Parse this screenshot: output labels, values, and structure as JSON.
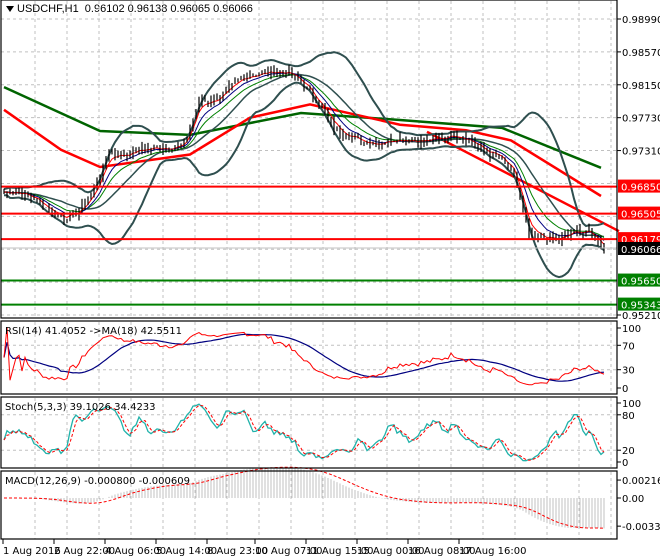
{
  "header": {
    "symbol": "USDCHF,H1",
    "open": "0.96102",
    "high": "0.96138",
    "low": "0.96065",
    "close": "0.96066"
  },
  "chart_data": {
    "type": "line",
    "title": "USDCHF,H1",
    "price_axis": {
      "range": [
        0.9521,
        0.9899
      ],
      "ticks": [
        {
          "value": 0.9899,
          "label": "0.98990"
        },
        {
          "value": 0.9857,
          "label": "0.98570"
        },
        {
          "value": 0.9815,
          "label": "0.98150"
        },
        {
          "value": 0.9773,
          "label": "0.97730"
        },
        {
          "value": 0.9731,
          "label": "0.97310"
        },
        {
          "value": 0.9521,
          "label": "0.95210"
        }
      ]
    },
    "time_axis": {
      "bars": 203,
      "ticks": [
        {
          "bar": 0,
          "label": "1 Aug 2016"
        },
        {
          "bar": 17,
          "label": "2 Aug 22:00"
        },
        {
          "bar": 34,
          "label": "4 Aug 06:00"
        },
        {
          "bar": 51,
          "label": "5 Aug 14:00"
        },
        {
          "bar": 68,
          "label": "8 Aug 23:00"
        },
        {
          "bar": 84,
          "label": "10 Aug 07:00"
        },
        {
          "bar": 101,
          "label": "11 Aug 15:00"
        },
        {
          "bar": 118,
          "label": "15 Aug 00:00"
        },
        {
          "bar": 135,
          "label": "16 Aug 08:00"
        },
        {
          "bar": 152,
          "label": "17 Aug 16:00"
        }
      ]
    },
    "close_every_5_bars": [
      0.9678,
      0.9678,
      0.967,
      0.9655,
      0.9645,
      0.9653,
      0.9681,
      0.9729,
      0.9725,
      0.9732,
      0.9734,
      0.9735,
      0.9738,
      0.9795,
      0.9795,
      0.981,
      0.9826,
      0.9829,
      0.9832,
      0.983,
      0.9815,
      0.979,
      0.976,
      0.9749,
      0.9742,
      0.974,
      0.9746,
      0.9745,
      0.9743,
      0.9746,
      0.9752,
      0.9745,
      0.973,
      0.9723,
      0.97,
      0.9622,
      0.9619,
      0.9617,
      0.9628,
      0.9627,
      0.9607
    ],
    "ma_slow_green": [
      [
        0,
        0.9812
      ],
      [
        32,
        0.9756
      ],
      [
        62,
        0.9751
      ],
      [
        99,
        0.9779
      ],
      [
        132,
        0.977
      ],
      [
        166,
        0.976
      ],
      [
        199,
        0.9709
      ]
    ],
    "ma_slow_red": [
      [
        0,
        0.9783
      ],
      [
        19,
        0.9732
      ],
      [
        32,
        0.971
      ],
      [
        62,
        0.9726
      ],
      [
        82,
        0.9773
      ],
      [
        102,
        0.979
      ],
      [
        132,
        0.9764
      ],
      [
        154,
        0.9757
      ],
      [
        169,
        0.9744
      ],
      [
        199,
        0.9673
      ]
    ],
    "trendline": [
      [
        141,
        0.9755
      ],
      [
        205,
        0.9628
      ]
    ],
    "levels": [
      {
        "value": 0.9685,
        "label": "0.96850",
        "color": "#ff0000"
      },
      {
        "value": 0.96505,
        "label": "0.96505",
        "color": "#ff0000"
      },
      {
        "value": 0.96179,
        "label": "0.96179",
        "color": "#ff0000"
      },
      {
        "value": 0.9565,
        "label": "0.95650",
        "color": "#008000"
      },
      {
        "value": 0.95343,
        "label": "0.95343",
        "color": "#008000"
      }
    ],
    "current_price": {
      "value": 0.96066,
      "label": "0.96066",
      "color": "#000000"
    },
    "rsi": {
      "label": "RSI(14) 41.4052  ->MA(18) 42.5511",
      "ticks": [
        {
          "v": 100,
          "label": "100"
        },
        {
          "v": 70,
          "label": "70"
        },
        {
          "v": 30,
          "label": "30"
        },
        {
          "v": 0,
          "label": "0"
        }
      ],
      "line_color": "#ff0000",
      "ma_color": "#000080"
    },
    "stoch": {
      "label": "Stoch(5,3,3) 39.1026 34.4233",
      "ticks": [
        {
          "v": 100,
          "label": "100"
        },
        {
          "v": 80,
          "label": "80"
        },
        {
          "v": 20,
          "label": "20"
        },
        {
          "v": 0,
          "label": "0"
        }
      ],
      "main_color": "#20b2aa",
      "signal_color": "#ff0000"
    },
    "macd": {
      "label": "MACD(12,26,9) -0.000800 -0.000609",
      "ticks": [
        {
          "v": 0.002161,
          "label": "0.002161"
        },
        {
          "v": 0,
          "label": "0.00"
        },
        {
          "v": -0.003391,
          "label": "-0.003391"
        }
      ],
      "hist_color": "#c0c0c0",
      "signal_color": "#ff0000"
    },
    "colors": {
      "bollinger": "#2f4f4f",
      "bars": "#000000",
      "ema_fast": "#ff0000",
      "ema_mid": "#000080",
      "ema_slow": "#008000",
      "ma_green": "#006400",
      "ma_red": "#ff0000",
      "grid": "#c0c0c0"
    }
  }
}
